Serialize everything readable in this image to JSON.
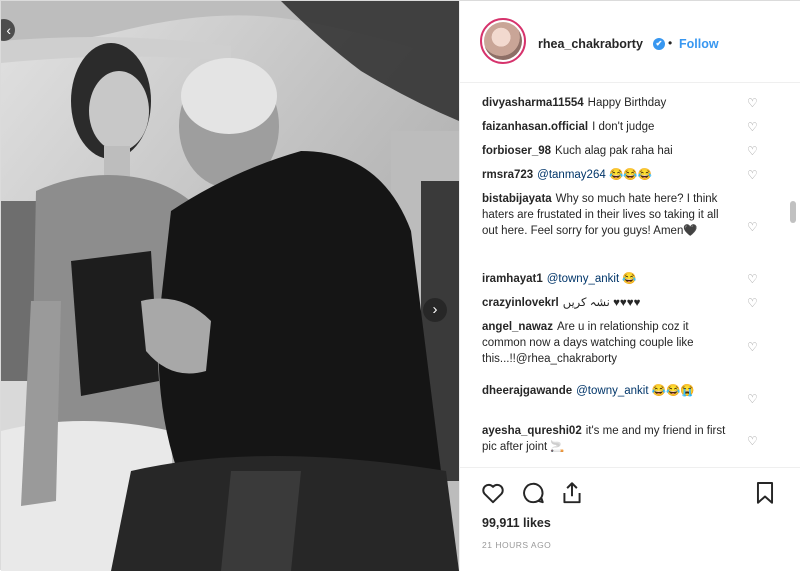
{
  "post": {
    "username": "rhea_chakraborty",
    "verified_badge": "✔",
    "separator": "•",
    "follow_label": "Follow",
    "likes": "99,911 likes",
    "timestamp": "21 HOURS AGO"
  },
  "photo": {
    "prev_glyph": "‹",
    "next_glyph": "›"
  },
  "comments": [
    {
      "user": "divyasharma11554",
      "text": "Happy Birthday"
    },
    {
      "user": "faizanhasan.official",
      "text": "I don't judge"
    },
    {
      "user": "forbioser_98",
      "text": "Kuch alag pak raha hai"
    },
    {
      "user": "rmsra723",
      "mention": "@tanmay264",
      "text": "😂😂😂"
    },
    {
      "user": "bistabijayata",
      "text": "Why so much hate here? I think haters are frustated in their lives so taking it all out here. Feel sorry for you guys! Amen🖤"
    },
    {
      "user": "iramhayat1",
      "mention": "@towny_ankit",
      "text": "😂"
    },
    {
      "user": "crazyinlovekrl",
      "text": "نشہ کریں ♥♥♥♥"
    },
    {
      "user": "angel_nawaz",
      "text": "Are u in relationship coz it common now a days watching couple like this...!!@rhea_chakraborty"
    },
    {
      "user": "dheerajgawande",
      "mention": "@towny_ankit",
      "text": "😂😂😭"
    },
    {
      "user": "ayesha_qureshi02",
      "text": "it's me and my friend in first pic after joint 🚬"
    }
  ],
  "icons": {
    "heart": "heart-icon",
    "comment": "comment-icon",
    "share": "share-icon",
    "save": "bookmark-icon"
  },
  "colors": {
    "accent": "#3897f0",
    "text": "#262626",
    "muted": "#999999",
    "mention": "#003569"
  }
}
